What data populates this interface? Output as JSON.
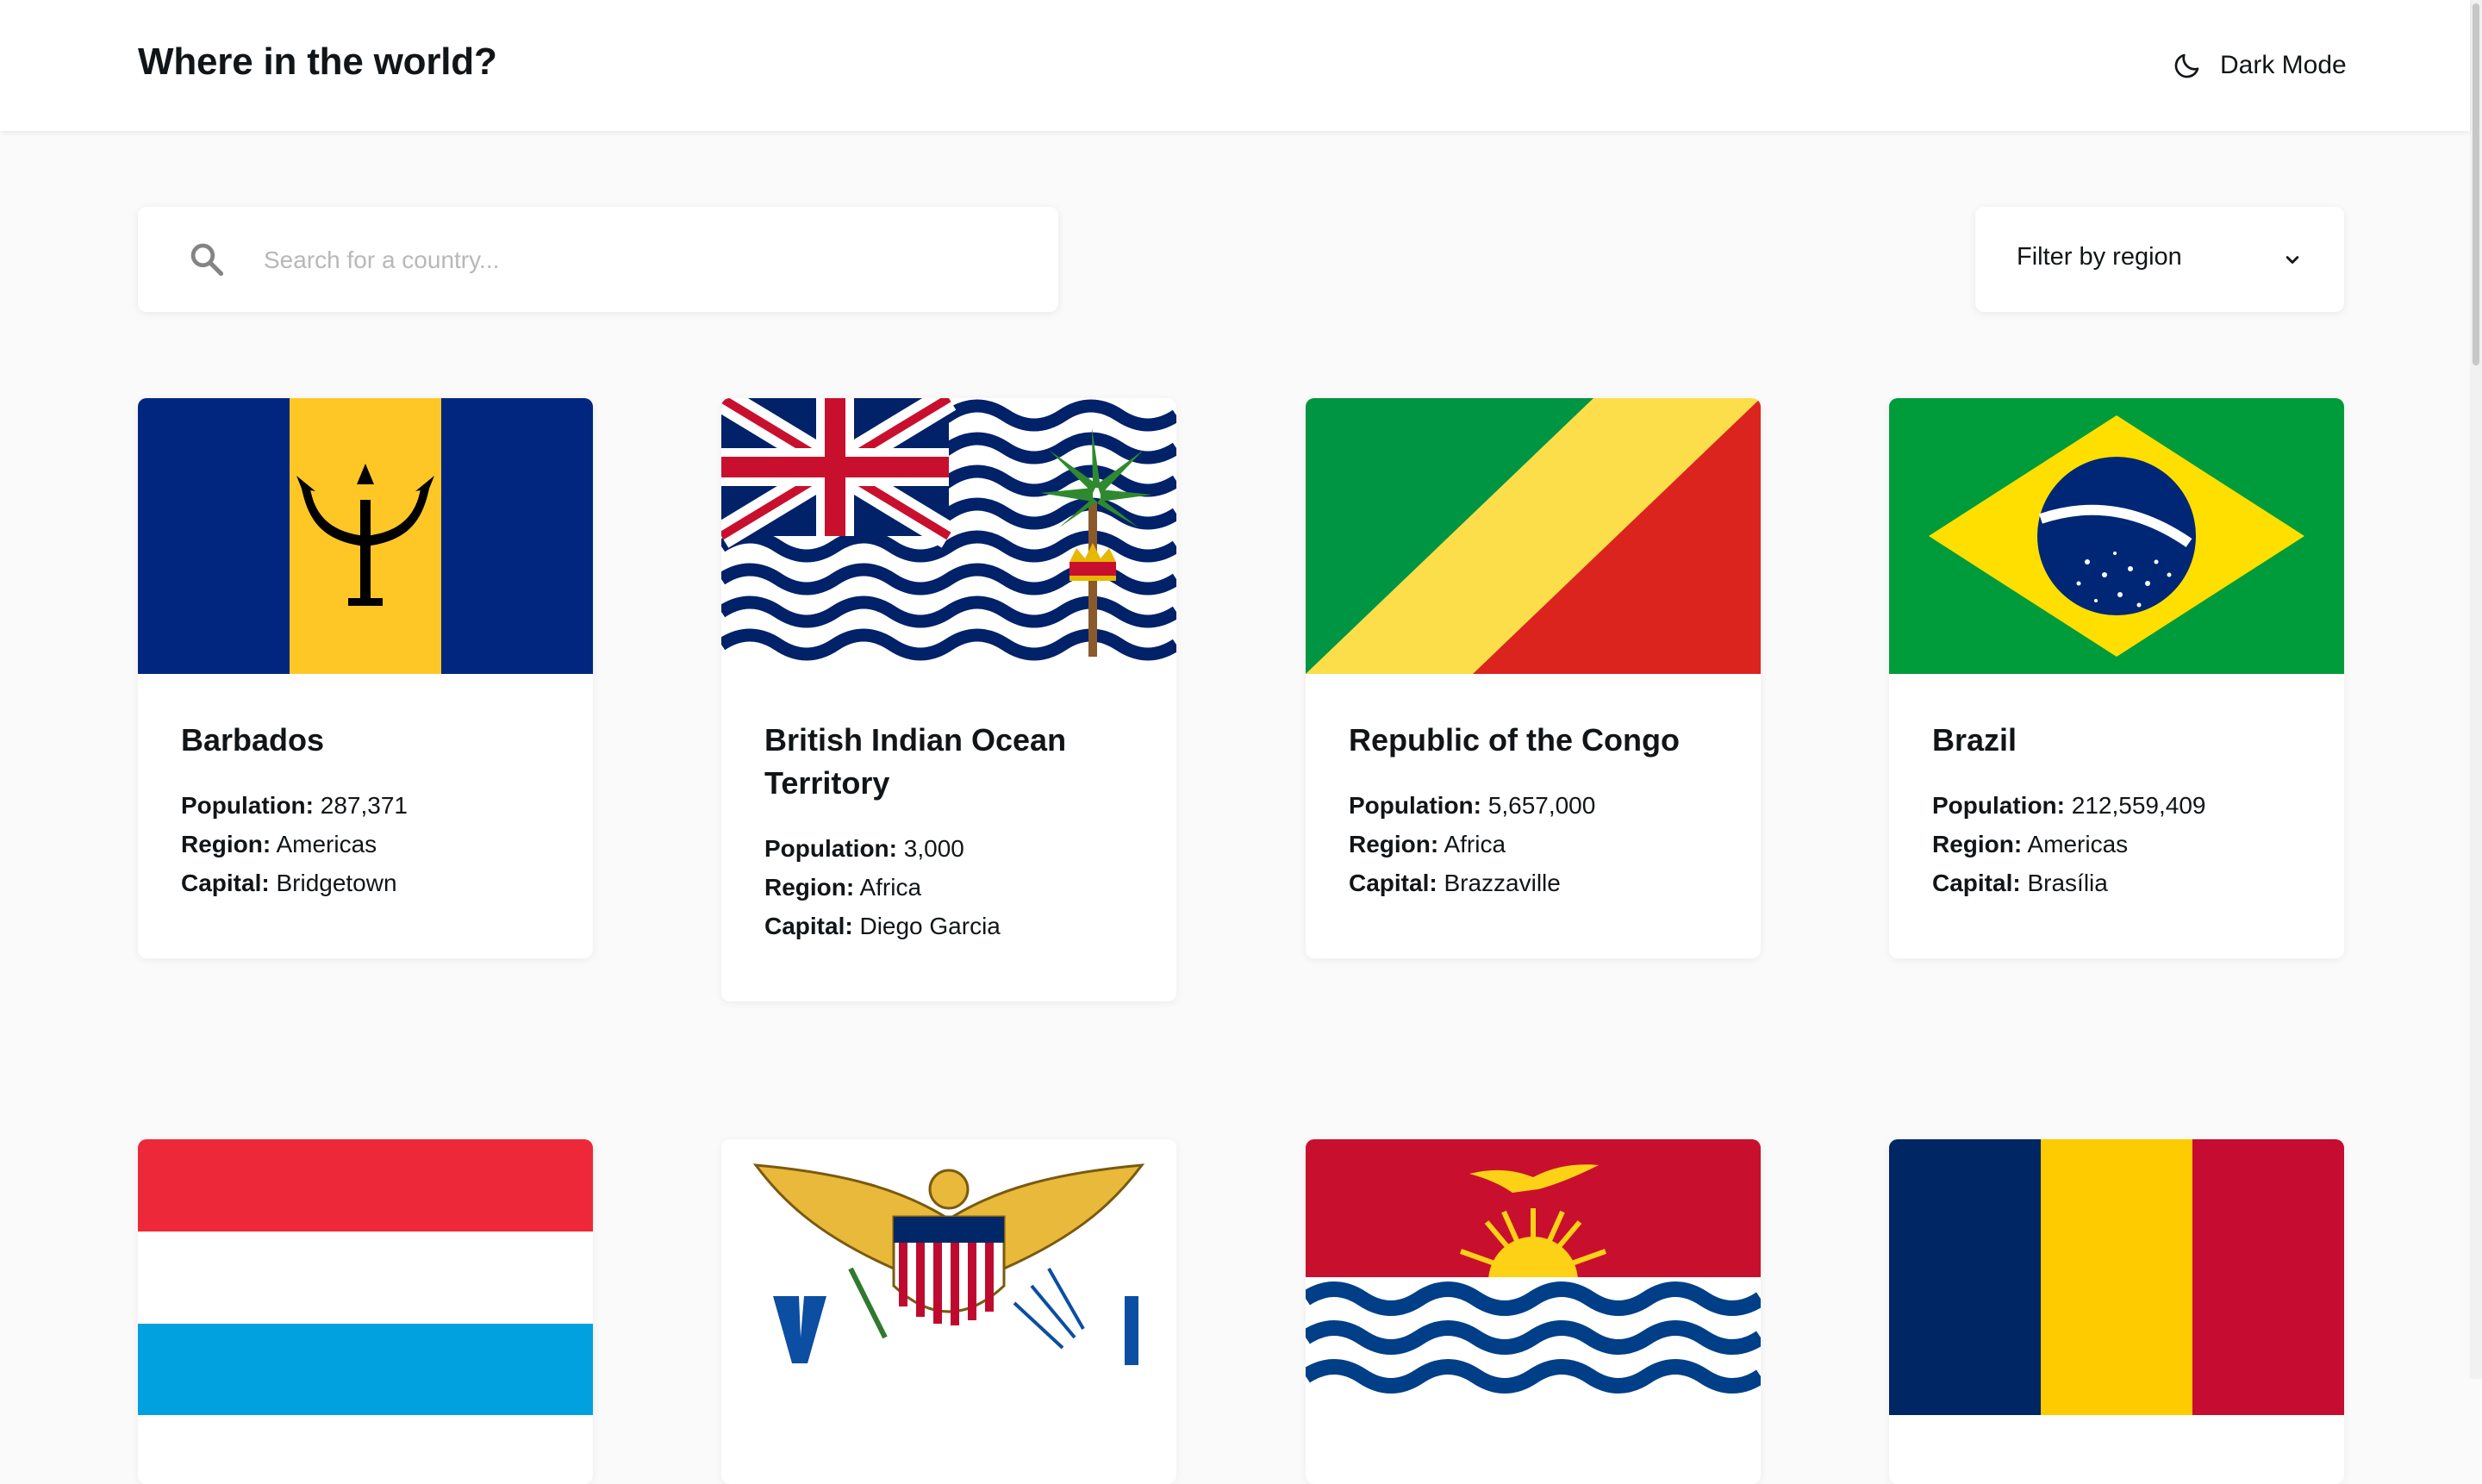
{
  "app": {
    "title": "Where in the world?"
  },
  "header": {
    "mode_label": "Dark Mode",
    "mode_icon": "moon-icon"
  },
  "search": {
    "placeholder": "Search for a country...",
    "value": "",
    "icon": "search-icon"
  },
  "filter": {
    "label": "Filter by region",
    "icon": "chevron-down-icon"
  },
  "labels": {
    "population": "Population:",
    "region": "Region:",
    "capital": "Capital:"
  },
  "countries": [
    {
      "name": "Barbados",
      "population": "287,371",
      "region": "Americas",
      "capital": "Bridgetown",
      "flag": "barbados-flag"
    },
    {
      "name": "British Indian Ocean Territory",
      "population": "3,000",
      "region": "Africa",
      "capital": "Diego Garcia",
      "flag": "british-indian-ocean-territory-flag"
    },
    {
      "name": "Republic of the Congo",
      "population": "5,657,000",
      "region": "Africa",
      "capital": "Brazzaville",
      "flag": "republic-of-the-congo-flag"
    },
    {
      "name": "Brazil",
      "population": "212,559,409",
      "region": "Americas",
      "capital": "Brasília",
      "flag": "brazil-flag"
    },
    {
      "flag": "luxembourg-flag"
    },
    {
      "flag": "us-virgin-islands-flag"
    },
    {
      "flag": "kiribati-flag"
    },
    {
      "flag": "chad-flag"
    }
  ],
  "colors": {
    "background": "#fafafa",
    "surface": "#ffffff",
    "text": "#111517",
    "placeholder": "#b8b8b8"
  }
}
